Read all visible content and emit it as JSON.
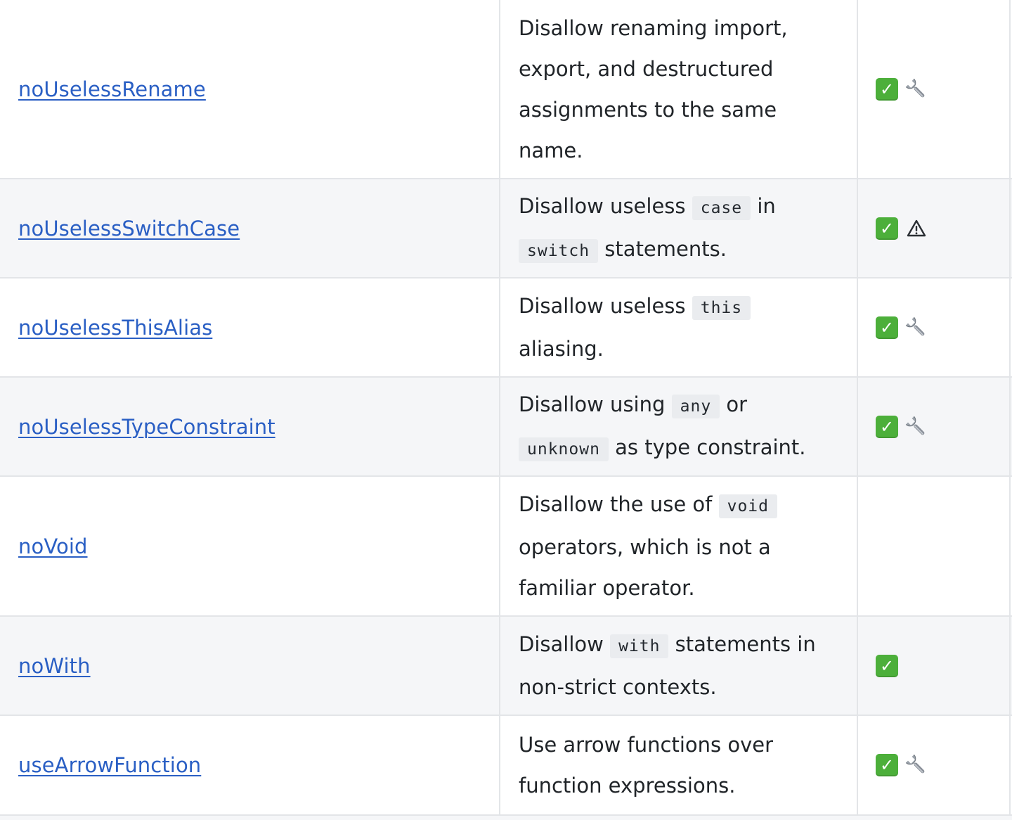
{
  "rules": [
    {
      "name": "noUselessRename",
      "description": [
        {
          "type": "text",
          "value": "Disallow renaming import, export, and destructured assignments to the same name."
        }
      ],
      "recommended": true,
      "fix": "wrench"
    },
    {
      "name": "noUselessSwitchCase",
      "description": [
        {
          "type": "text",
          "value": "Disallow useless "
        },
        {
          "type": "code",
          "value": "case"
        },
        {
          "type": "text",
          "value": " in "
        },
        {
          "type": "code",
          "value": "switch"
        },
        {
          "type": "text",
          "value": " statements."
        }
      ],
      "recommended": true,
      "fix": "warning"
    },
    {
      "name": "noUselessThisAlias",
      "description": [
        {
          "type": "text",
          "value": "Disallow useless "
        },
        {
          "type": "code",
          "value": "this"
        },
        {
          "type": "text",
          "value": " aliasing."
        }
      ],
      "recommended": true,
      "fix": "wrench"
    },
    {
      "name": "noUselessTypeConstraint",
      "description": [
        {
          "type": "text",
          "value": "Disallow using "
        },
        {
          "type": "code",
          "value": "any"
        },
        {
          "type": "text",
          "value": " or "
        },
        {
          "type": "code",
          "value": "unknown"
        },
        {
          "type": "text",
          "value": " as type constraint."
        }
      ],
      "recommended": true,
      "fix": "wrench"
    },
    {
      "name": "noVoid",
      "description": [
        {
          "type": "text",
          "value": "Disallow the use of "
        },
        {
          "type": "code",
          "value": "void"
        },
        {
          "type": "text",
          "value": " operators, which is not a familiar operator."
        }
      ],
      "recommended": false,
      "fix": ""
    },
    {
      "name": "noWith",
      "description": [
        {
          "type": "text",
          "value": "Disallow "
        },
        {
          "type": "code",
          "value": "with"
        },
        {
          "type": "text",
          "value": " statements in non-strict contexts."
        }
      ],
      "recommended": true,
      "fix": ""
    },
    {
      "name": "useArrowFunction",
      "description": [
        {
          "type": "text",
          "value": "Use arrow functions over function expressions."
        }
      ],
      "recommended": true,
      "fix": "wrench"
    }
  ],
  "icons": {
    "recommended": "check-icon",
    "wrench": "wrench-icon",
    "warning": "warning-icon"
  },
  "colors": {
    "link": "#2a5fc4",
    "row_alt_bg": "#f5f6f8",
    "border": "#e3e5e8",
    "check_bg": "#4caf3a",
    "code_bg": "#eaecef"
  }
}
